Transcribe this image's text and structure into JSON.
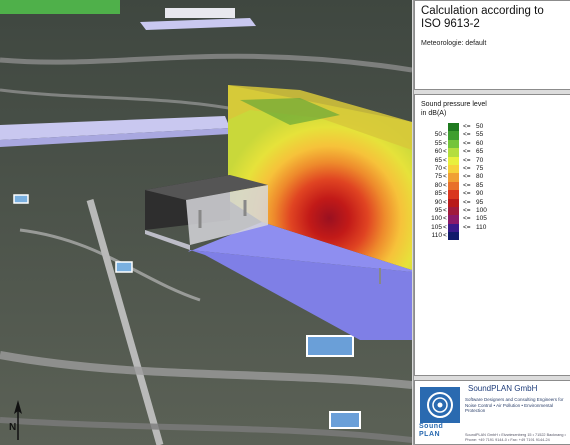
{
  "panel": {
    "title": "Calculation according to ISO 9613-2",
    "meteorology": "Meteorologie: default"
  },
  "legend": {
    "heading_line1": "Sound pressure level",
    "heading_line2": "in dB(A)",
    "rows": [
      {
        "lo": "",
        "lt": "",
        "le": "<=",
        "hi": "50",
        "color": "#1f7a1f"
      },
      {
        "lo": "50",
        "lt": "<",
        "le": "<=",
        "hi": "55",
        "color": "#3f9e2f"
      },
      {
        "lo": "55",
        "lt": "<",
        "le": "<=",
        "hi": "60",
        "color": "#74c43a"
      },
      {
        "lo": "60",
        "lt": "<",
        "le": "<=",
        "hi": "65",
        "color": "#b4de3e"
      },
      {
        "lo": "65",
        "lt": "<",
        "le": "<=",
        "hi": "70",
        "color": "#e8f03c"
      },
      {
        "lo": "70",
        "lt": "<",
        "le": "<=",
        "hi": "75",
        "color": "#f6d23a"
      },
      {
        "lo": "75",
        "lt": "<",
        "le": "<=",
        "hi": "80",
        "color": "#f0a033"
      },
      {
        "lo": "80",
        "lt": "<",
        "le": "<=",
        "hi": "85",
        "color": "#e8702a"
      },
      {
        "lo": "85",
        "lt": "<",
        "le": "<=",
        "hi": "90",
        "color": "#d9361f"
      },
      {
        "lo": "90",
        "lt": "<",
        "le": "<=",
        "hi": "95",
        "color": "#b81a1a"
      },
      {
        "lo": "95",
        "lt": "<",
        "le": "<=",
        "hi": "100",
        "color": "#a01a3c"
      },
      {
        "lo": "100",
        "lt": "<",
        "le": "<=",
        "hi": "105",
        "color": "#8a1a6a"
      },
      {
        "lo": "105",
        "lt": "<",
        "le": "<=",
        "hi": "110",
        "color": "#3a1a8a"
      },
      {
        "lo": "110",
        "lt": "<",
        "le": "",
        "hi": "",
        "color": "#101a6a"
      }
    ]
  },
  "logo": {
    "company": "SoundPLAN GmbH",
    "word_top": "Sound",
    "word_bottom": "PLAN",
    "tagline": "Software Designers and Consulting Engineers for Noise Control • Air Pollution • Environmental Protection",
    "contact": "SoundPLAN GmbH • Etzwiesenberg 15 • 71522 Backnang • Phone: +49 7191 9144-0 • Fax: +49 7191 9144-24"
  },
  "north_label": "N",
  "colors": {
    "ground_water": "#7f7fe6",
    "building_dark": "#3a3a3a",
    "accent_blue": "#2a6ab0"
  }
}
